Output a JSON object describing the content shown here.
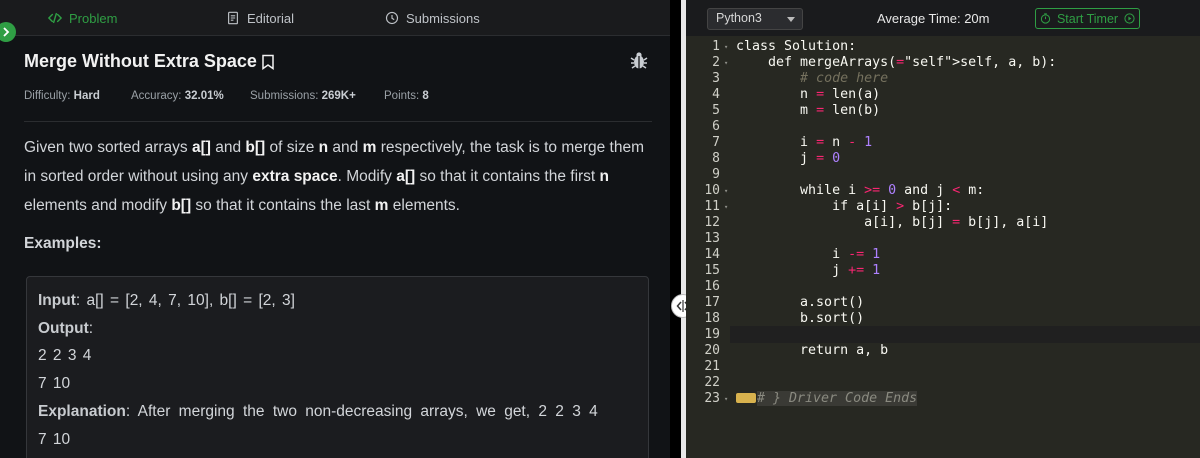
{
  "tabs": {
    "problem": "Problem",
    "editorial": "Editorial",
    "submissions": "Submissions"
  },
  "problem": {
    "title": "Merge Without Extra Space",
    "difficulty_label": "Difficulty:",
    "difficulty_value": "Hard",
    "accuracy_label": "Accuracy:",
    "accuracy_value": "32.01%",
    "submissions_label": "Submissions:",
    "submissions_value": "269K+",
    "points_label": "Points:",
    "points_value": "8",
    "description": {
      "p1": "Given two sorted arrays ",
      "a": "a[]",
      "p2": " and ",
      "b": "b[]",
      "p3": " of size ",
      "n": "n",
      "p4": " and ",
      "m": "m",
      "p5": " respectively, the task is to merge them in sorted order without using any ",
      "extra": "extra space",
      "p6": ". Modify ",
      "a2": "a[]",
      "p7": " so that it contains the first ",
      "n2": "n",
      "p8": " elements and modify ",
      "b2": "b[]",
      "p9": " so that it contains the last ",
      "m2": "m",
      "p10": " elements."
    },
    "examples_heading": "Examples:",
    "example": {
      "input_label": "Input",
      "input_value": ": a[] = [2, 4, 7, 10], b[] = [2, 3]",
      "output_label": "Output",
      "output_colon": ":",
      "output_line1": "2 2 3 4",
      "output_line2": "7 10",
      "explanation_label": "Explanation",
      "explanation_text": ": After merging the two non-decreasing arrays, we get, 2 2 3 4",
      "explanation_line2": "7 10"
    }
  },
  "editor": {
    "language": "Python3",
    "average_time": "Average Time: 20m",
    "timer_button": "Start Timer",
    "line_numbers": [
      "1",
      "2",
      "3",
      "4",
      "5",
      "6",
      "7",
      "8",
      "9",
      "10",
      "11",
      "12",
      "13",
      "14",
      "15",
      "16",
      "17",
      "18",
      "19",
      "20",
      "21",
      "22",
      "23"
    ],
    "code_lines": [
      "class Solution:",
      "    def mergeArrays(self, a, b):",
      "        # code here",
      "        n = len(a)",
      "        m = len(b)",
      "",
      "        i = n - 1",
      "        j = 0",
      "",
      "        while i >= 0 and j < m:",
      "            if a[i] > b[j]:",
      "                a[i], b[j] = b[j], a[i]",
      "",
      "            i -= 1",
      "            j += 1",
      "",
      "        a.sort()",
      "        b.sort()",
      "",
      "        return a, b",
      "",
      "",
      "# } Driver Code Ends"
    ],
    "colors": {
      "background": "#272822",
      "accent": "#2f9e44"
    }
  }
}
